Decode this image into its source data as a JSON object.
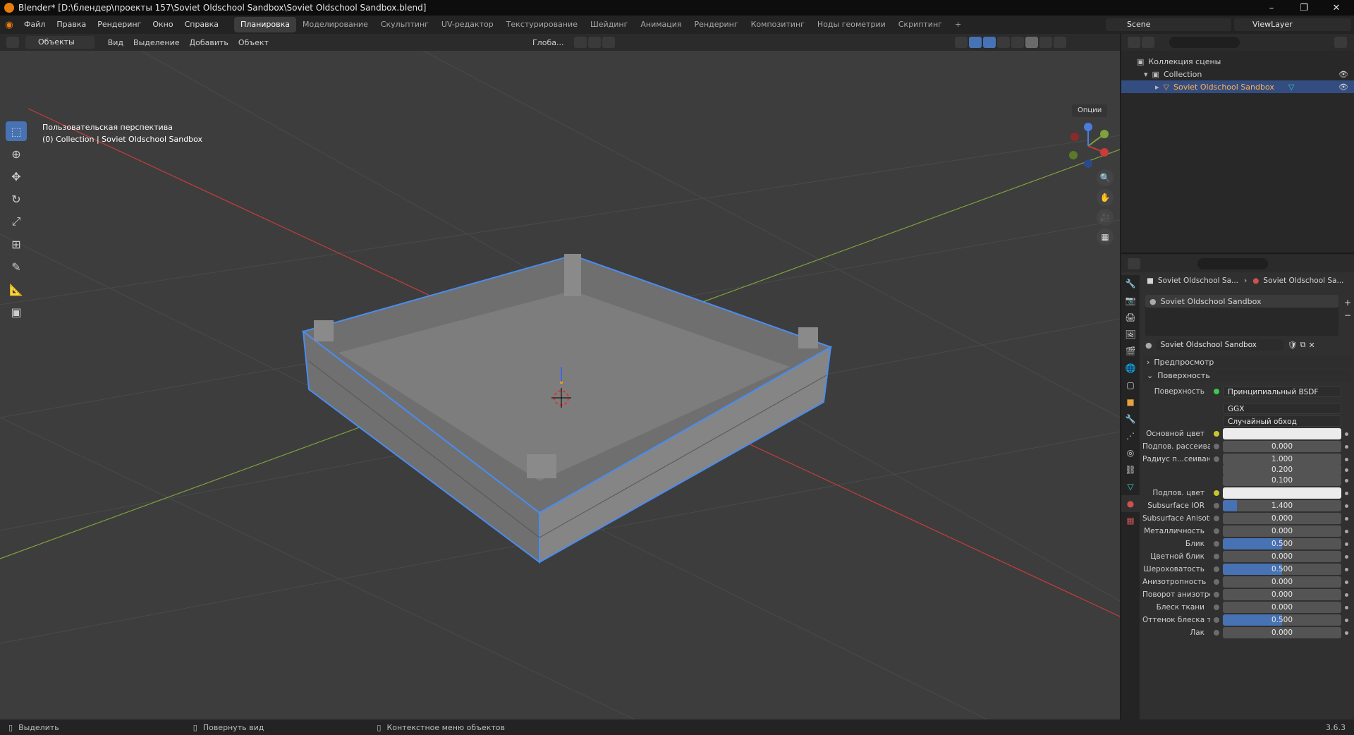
{
  "window": {
    "title": "Blender* [D:\\блендер\\проекты 157\\Soviet Oldschool Sandbox\\Soviet Oldschool Sandbox.blend]",
    "minimize": "–",
    "maximize": "❐",
    "close": "✕"
  },
  "menu": [
    "Файл",
    "Правка",
    "Рендеринг",
    "Окно",
    "Справка"
  ],
  "workspaces": [
    "Планировка",
    "Моделирование",
    "Скульптинг",
    "UV-редактор",
    "Текстурирование",
    "Шейдинг",
    "Анимация",
    "Рендеринг",
    "Композитинг",
    "Ноды геометрии",
    "Скриптинг",
    "+"
  ],
  "scene": {
    "name": "Scene",
    "view_layer": "ViewLayer"
  },
  "viewport_header": {
    "mode": "Объекты",
    "items": [
      "Вид",
      "Выделение",
      "Добавить",
      "Объект"
    ],
    "transform_orientation": "Глоба...",
    "options": "Опции"
  },
  "viewport": {
    "view_name": "Пользовательская перспектива",
    "collection_info": "(0) Collection | Soviet Oldschool Sandbox"
  },
  "outliner": {
    "scene_collection": "Коллекция сцены",
    "collection": "Collection",
    "object": "Soviet Oldschool Sandbox"
  },
  "properties": {
    "breadcrumb_object": "Soviet Oldschool Sa...",
    "breadcrumb_material": "Soviet Oldschool Sa...",
    "material_slot": "Soviet Oldschool Sandbox",
    "material_name": "Soviet Oldschool Sandbox",
    "preview_label": "Предпросмотр",
    "surface_section": "Поверхность",
    "surface_label": "Поверхность",
    "surface_value": "Принципиальный BSDF",
    "distribution": "GGX",
    "subsurface_method": "Случайный обход",
    "rows": [
      {
        "label": "Основной цвет",
        "type": "color"
      },
      {
        "label": "Подпов. рассеива...",
        "value": "0.000",
        "fill": 0
      },
      {
        "label": "Радиус п...сеивания",
        "value": "1.000",
        "fill": 0
      },
      {
        "label": "",
        "value": "0.200",
        "fill": 0
      },
      {
        "label": "",
        "value": "0.100",
        "fill": 0
      },
      {
        "label": "Подпов. цвет",
        "type": "color"
      },
      {
        "label": "Subsurface IOR",
        "value": "1.400",
        "fill": 0.12
      },
      {
        "label": "Subsurface Anisotr...",
        "value": "0.000",
        "fill": 0
      },
      {
        "label": "Металличность",
        "value": "0.000",
        "fill": 0
      },
      {
        "label": "Блик",
        "value": "0.500",
        "fill": 0.5
      },
      {
        "label": "Цветной блик",
        "value": "0.000",
        "fill": 0
      },
      {
        "label": "Шероховатость",
        "value": "0.500",
        "fill": 0.5
      },
      {
        "label": "Анизотропность",
        "value": "0.000",
        "fill": 0
      },
      {
        "label": "Поворот анизотро...",
        "value": "0.000",
        "fill": 0
      },
      {
        "label": "Блеск ткани",
        "value": "0.000",
        "fill": 0
      },
      {
        "label": "Оттенок блеска тк...",
        "value": "0.500",
        "fill": 0.5
      },
      {
        "label": "Лак",
        "value": "0.000",
        "fill": 0
      }
    ]
  },
  "statusbar": {
    "select": "Выделить",
    "rotate": "Повернуть вид",
    "context_menu": "Контекстное меню объектов",
    "version": "3.6.3"
  },
  "colors": {
    "selection_outline": "#4a8cf0",
    "active_tab": "#4772b3",
    "x_axis": "#c83c3c",
    "y_axis": "#7ea33b"
  }
}
